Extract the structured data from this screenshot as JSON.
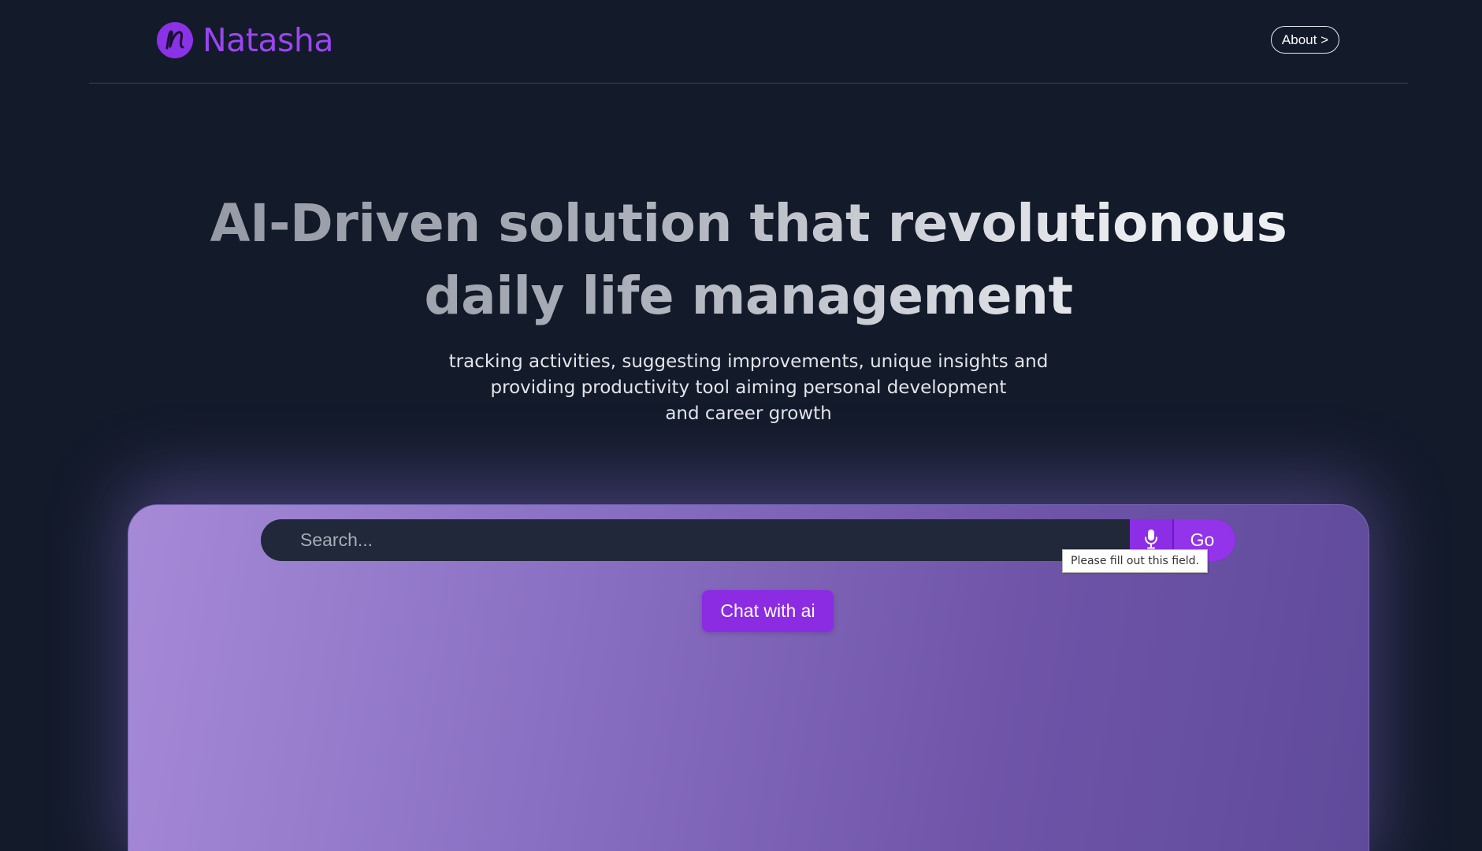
{
  "header": {
    "brand_name": "Natasha",
    "about_label": "About >"
  },
  "hero": {
    "title_line1": "AI-Driven solution that revolutionous",
    "title_line2": "daily life management",
    "subtitle_line1": "tracking activities, suggesting improvements, unique insights and",
    "subtitle_line2": "providing productivity tool aiming personal development",
    "subtitle_line3": "and career growth"
  },
  "search": {
    "placeholder": "Search...",
    "value": "",
    "mic_icon": "microphone-icon",
    "go_label": "Go",
    "validation_tooltip": "Please fill out this field."
  },
  "chat": {
    "button_label": "Chat with ai"
  },
  "colors": {
    "background": "#131a2a",
    "brand_purple": "#9333ea",
    "panel_gradient_start": "#a68ad8",
    "panel_gradient_end": "#5f4a9a"
  }
}
